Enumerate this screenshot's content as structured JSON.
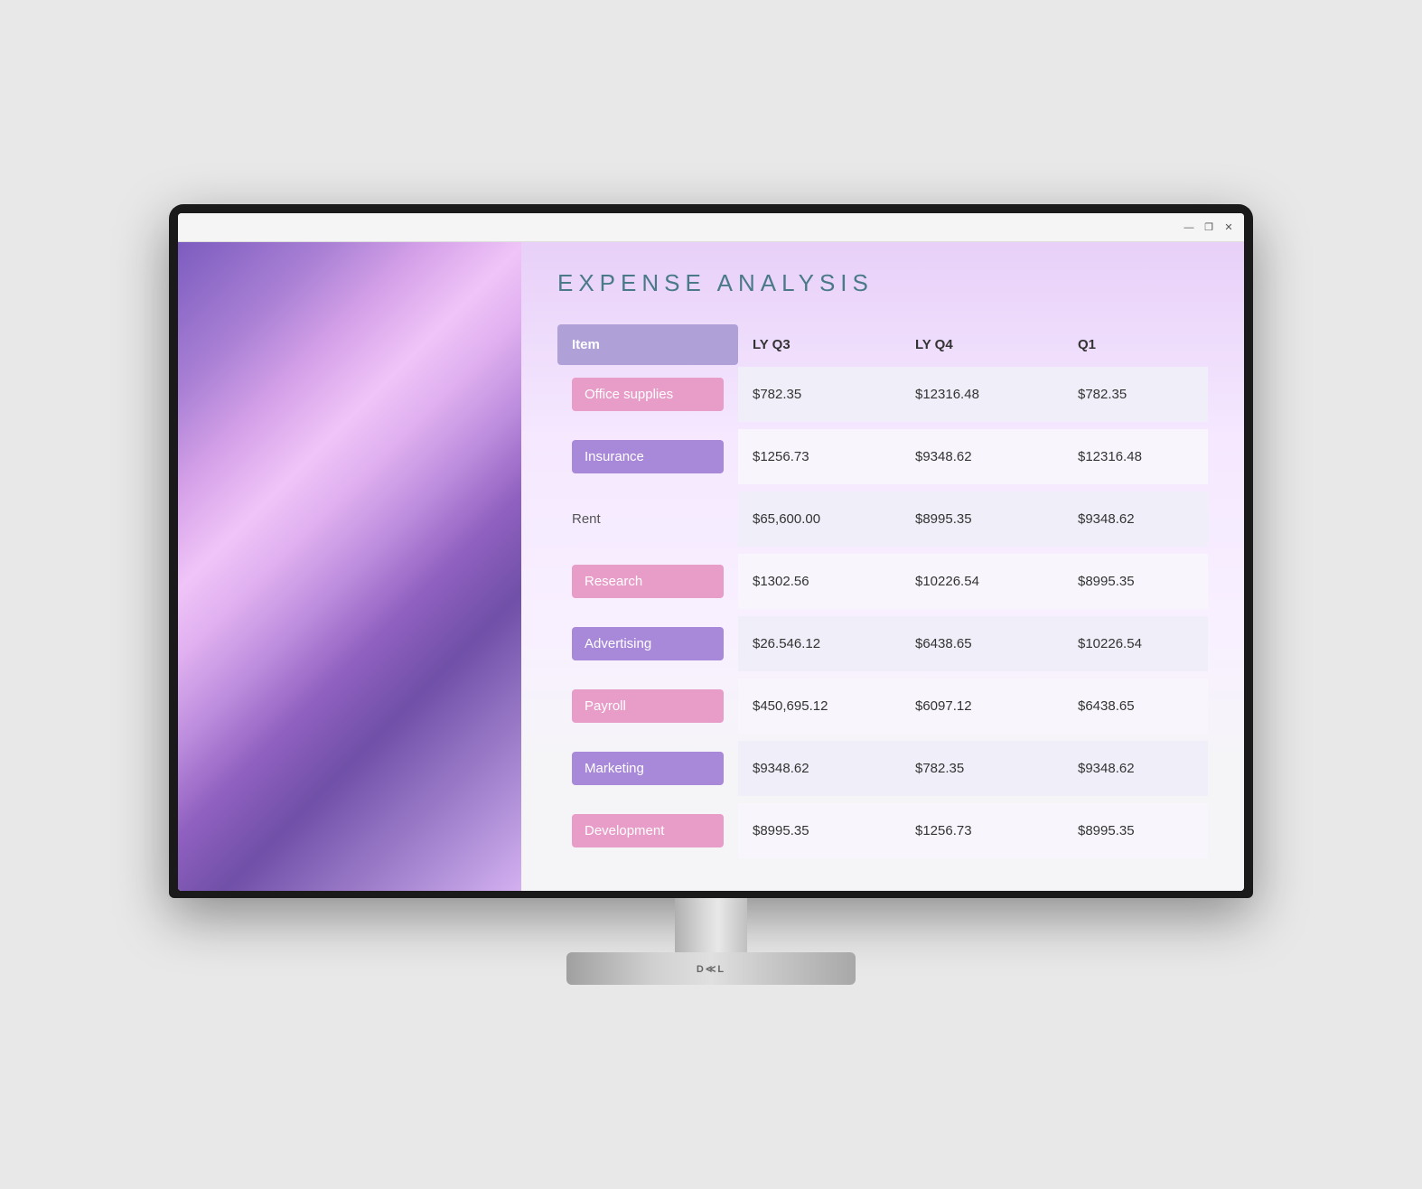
{
  "title_bar": {
    "minimize": "—",
    "restore": "❐",
    "close": "✕"
  },
  "page": {
    "title": "EXPENSE ANALYSIS"
  },
  "table": {
    "headers": [
      "Item",
      "LY Q3",
      "LY Q4",
      "Q1"
    ],
    "rows": [
      {
        "item": "Office supplies",
        "item_style": "pink",
        "lyq3": "$782.35",
        "lyq4": "$12316.48",
        "q1": "$782.35",
        "row_style": "odd"
      },
      {
        "item": "Insurance",
        "item_style": "purple",
        "lyq3": "$1256.73",
        "lyq4": "$9348.62",
        "q1": "$12316.48",
        "row_style": "even"
      },
      {
        "item": "Rent",
        "item_style": "none",
        "lyq3": "$65,600.00",
        "lyq4": "$8995.35",
        "q1": "$9348.62",
        "row_style": "odd"
      },
      {
        "item": "Research",
        "item_style": "pink",
        "lyq3": "$1302.56",
        "lyq4": "$10226.54",
        "q1": "$8995.35",
        "row_style": "even"
      },
      {
        "item": "Advertising",
        "item_style": "purple",
        "lyq3": "$26.546.12",
        "lyq4": "$6438.65",
        "q1": "$10226.54",
        "row_style": "odd"
      },
      {
        "item": "Payroll",
        "item_style": "pink",
        "lyq3": "$450,695.12",
        "lyq4": "$6097.12",
        "q1": "$6438.65",
        "row_style": "even"
      },
      {
        "item": "Marketing",
        "item_style": "purple",
        "lyq3": "$9348.62",
        "lyq4": "$782.35",
        "q1": "$9348.62",
        "row_style": "odd"
      },
      {
        "item": "Development",
        "item_style": "pink",
        "lyq3": "$8995.35",
        "lyq4": "$1256.73",
        "q1": "$8995.35",
        "row_style": "even"
      }
    ]
  },
  "dell_logo": "D≪L"
}
